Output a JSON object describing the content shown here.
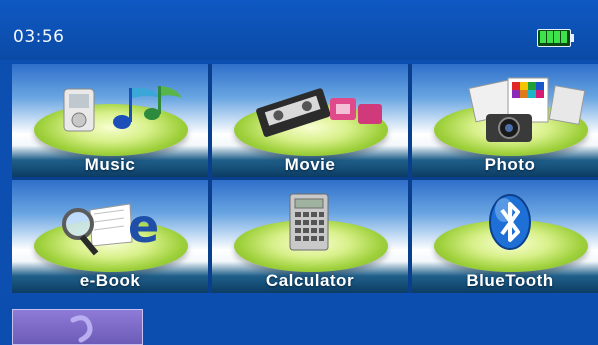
{
  "status": {
    "time": "03:56",
    "battery_icon": "battery-full-icon",
    "battery_level": 1.0
  },
  "menu": {
    "items": [
      {
        "label": "Music",
        "icon": "music-player-icon"
      },
      {
        "label": "Movie",
        "icon": "video-tape-icon"
      },
      {
        "label": "Photo",
        "icon": "camera-photos-icon"
      },
      {
        "label": "e-Book",
        "icon": "ebook-magnifier-icon"
      },
      {
        "label": "Calculator",
        "icon": "calculator-icon"
      },
      {
        "label": "BlueTooth",
        "icon": "bluetooth-icon"
      }
    ]
  },
  "colors": {
    "background": "#0d4fb0",
    "accent": "#9ed03b",
    "battery": "#3ee24a"
  }
}
